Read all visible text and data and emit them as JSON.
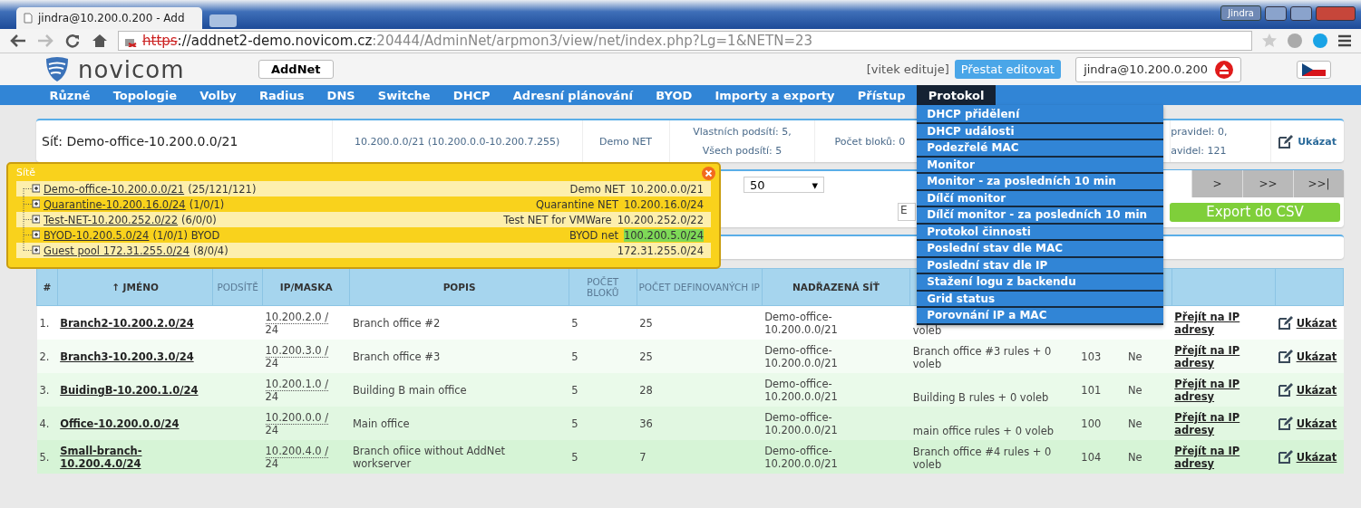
{
  "browser": {
    "tab_title": "jindra@10.200.0.200 - Add",
    "user_badge": "Jindra",
    "url_scheme": "https",
    "url_host": "://addnet2-demo.novicom.cz",
    "url_path": ":20444/AdminNet/arpmon3/view/net/index.php?Lg=1&NETN=23"
  },
  "header": {
    "logo_text": "novicom",
    "app_button": "AddNet",
    "editing_note": "[vitek edituje]",
    "stop_edit_button": "Přestat editovat",
    "user": "jindra@10.200.0.200"
  },
  "nav": [
    {
      "label": "Různé",
      "selected": false
    },
    {
      "label": "Topologie",
      "selected": false
    },
    {
      "label": "Volby",
      "selected": false
    },
    {
      "label": "Radius",
      "selected": false
    },
    {
      "label": "DNS",
      "selected": false
    },
    {
      "label": "Switche",
      "selected": false
    },
    {
      "label": "DHCP",
      "selected": false
    },
    {
      "label": "Adresní plánování",
      "selected": false
    },
    {
      "label": "BYOD",
      "selected": false
    },
    {
      "label": "Importy a exporty",
      "selected": false
    },
    {
      "label": "Přístup",
      "selected": false
    },
    {
      "label": "Protokol",
      "selected": true
    }
  ],
  "protokol_menu": [
    "DHCP přidělení",
    "DHCP události",
    "Podezřelé MAC",
    "Monitor",
    "Monitor - za posledních 10 min",
    "Dílčí monitor",
    "Dílčí monitor - za posledních 10 min",
    "Protokol činnosti",
    "Poslední stav dle MAC",
    "Poslední stav dle IP",
    "Stažení logu z backendu",
    "Grid status",
    "Porovnání IP a MAC"
  ],
  "info": {
    "net": "Síť: Demo-office-10.200.0.0/21",
    "range": "10.200.0.0/21 (10.200.0.0-10.200.7.255)",
    "desc": "Demo NET",
    "own_subnets": "Vlastních podsítí: 5,",
    "all_subnets": "Všech podsítí: 5",
    "blocks": "Počet bloků: 0",
    "rules_1": "pravidel: 0,",
    "rules_2": "avidel: 121",
    "show_link": "Ukázat"
  },
  "controls": {
    "page_size": "50",
    "page_size_caret": "▾",
    "filter_value": "E",
    "pager": [
      ">",
      ">>",
      ">>|"
    ],
    "export_button": "Export do CSV"
  },
  "popup": {
    "title": "Sítě",
    "rows": [
      {
        "link": "Demo-office-10.200.0.0/21",
        "counts": "(25/121/121)",
        "desc": "Demo NET",
        "net": "10.200.0.0/21",
        "highlight": false
      },
      {
        "link": "Quarantine-10.200.16.0/24",
        "counts": "(1/0/1)",
        "desc": "Quarantine NET",
        "net": "10.200.16.0/24",
        "highlight": false
      },
      {
        "link": "Test-NET-10.200.252.0/22",
        "counts": "(6/0/0)",
        "desc": "Test NET for VMWare",
        "net": "10.200.252.0/22",
        "highlight": false
      },
      {
        "link": "BYOD-10.200.5.0/24",
        "counts": "(1/0/1) BYOD",
        "desc": "BYOD net",
        "net": "100.200.5.0/24",
        "highlight": true
      },
      {
        "link": "Guest pool 172.31.255.0/24",
        "counts": "(8/0/4)",
        "desc": "",
        "net": "172.31.255.0/24",
        "highlight": false
      }
    ]
  },
  "table": {
    "columns": [
      "#",
      "↑ JMÉNO",
      "PODSÍTĚ",
      "IP/MASKA",
      "POPIS",
      "POČET BLOKŮ",
      "POČET DEFINOVANÝCH IP",
      "NADŘAZENÁ SÍŤ"
    ],
    "rows": [
      {
        "num": "1.",
        "name": "Branch2-10.200.2.0/24",
        "ip": "10.200.2.0 /",
        "mask": "24",
        "desc": "Branch office #2",
        "blocks": "5",
        "ips": "25",
        "parent": "Demo-office-\n10.200.0.0/21",
        "rules": "voleb",
        "rule_id": "",
        "dhcp": "",
        "goto": "Přejít na IP adresy",
        "show": "Ukázat"
      },
      {
        "num": "2.",
        "name": "Branch3-10.200.3.0/24",
        "ip": "10.200.3.0 /",
        "mask": "24",
        "desc": "Branch office #3",
        "blocks": "5",
        "ips": "25",
        "parent": "Demo-office-\n10.200.0.0/21",
        "rules": "Branch office #3 rules + 0\nvoleb",
        "rule_id": "103",
        "dhcp": "Ne",
        "goto": "Přejít na IP adresy",
        "show": "Ukázat"
      },
      {
        "num": "3.",
        "name": "BuidingB-10.200.1.0/24",
        "ip": "10.200.1.0 /",
        "mask": "24",
        "desc": "Building B main office",
        "blocks": "5",
        "ips": "28",
        "parent": "Demo-office-\n10.200.0.0/21",
        "rules": "Building B rules + 0 voleb",
        "rule_id": "101",
        "dhcp": "Ne",
        "goto": "Přejít na IP adresy",
        "show": "Ukázat"
      },
      {
        "num": "4.",
        "name": "Office-10.200.0.0/24",
        "ip": "10.200.0.0 /",
        "mask": "24",
        "desc": "Main office",
        "blocks": "5",
        "ips": "36",
        "parent": "Demo-office-\n10.200.0.0/21",
        "rules": "main office rules + 0 voleb",
        "rule_id": "100",
        "dhcp": "Ne",
        "goto": "Přejít na IP adresy",
        "show": "Ukázat"
      },
      {
        "num": "5.",
        "name": "Small-branch-\n10.200.4.0/24",
        "ip": "10.200.4.0 /",
        "mask": "24",
        "desc": "Branch ofiice without AddNet\nworkserver",
        "blocks": "5",
        "ips": "7",
        "parent": "Demo-office-\n10.200.0.0/21",
        "rules": "Branch office #4 rules + 0\nvoleb",
        "rule_id": "104",
        "dhcp": "Ne",
        "goto": "Přejít na IP adresy",
        "show": "Ukázat"
      }
    ]
  }
}
